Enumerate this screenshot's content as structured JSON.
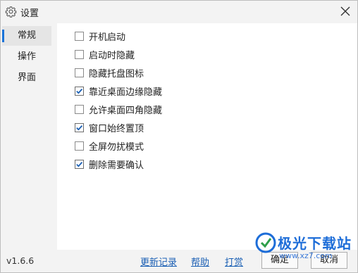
{
  "window": {
    "title": "设置"
  },
  "sidebar": {
    "items": [
      {
        "label": "常规",
        "active": true
      },
      {
        "label": "操作",
        "active": false
      },
      {
        "label": "界面",
        "active": false
      }
    ]
  },
  "options": [
    {
      "label": "开机启动",
      "checked": false
    },
    {
      "label": "启动时隐藏",
      "checked": false
    },
    {
      "label": "隐藏托盘图标",
      "checked": false
    },
    {
      "label": "靠近桌面边缘隐藏",
      "checked": true
    },
    {
      "label": "允许桌面四角隐藏",
      "checked": false
    },
    {
      "label": "窗口始终置顶",
      "checked": true
    },
    {
      "label": "全屏勿扰模式",
      "checked": false
    },
    {
      "label": "删除需要确认",
      "checked": true
    }
  ],
  "footer": {
    "version": "v1.6.6",
    "links": [
      "更新记录",
      "帮助",
      "打赏"
    ],
    "ok_label": "确定",
    "cancel_label": "取消"
  },
  "watermark": {
    "text": "极光下载站",
    "url": "www.xz7.com"
  },
  "colors": {
    "accent": "#1a73d9",
    "link": "#1a5fb4",
    "check": "#1a5fb4"
  }
}
